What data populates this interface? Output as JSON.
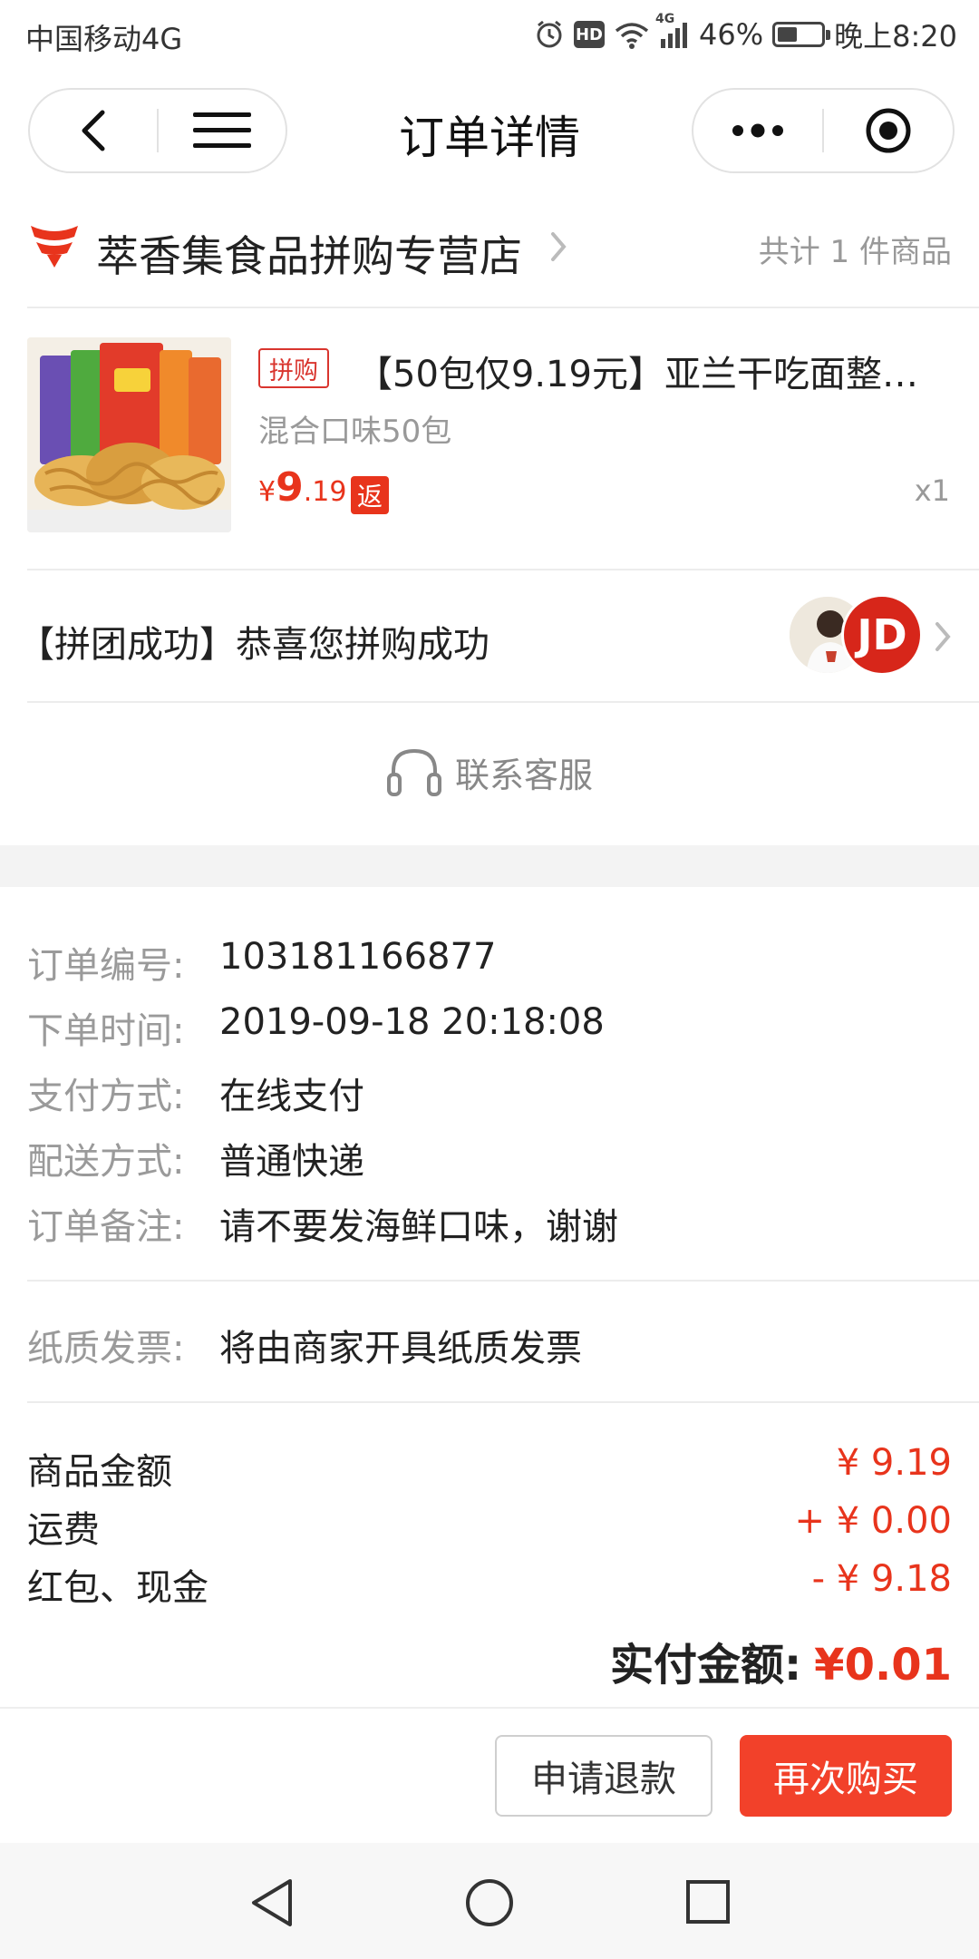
{
  "status_bar": {
    "carrier": "中国移动4G",
    "hd": "HD",
    "network": "4G",
    "battery": "46%",
    "battery_fraction": 0.46,
    "time": "晚上8:20"
  },
  "nav": {
    "title": "订单详情",
    "back_icon": "chevron-left-icon",
    "menu_icon": "hamburger-menu-icon",
    "more_icon": "more-dots-icon",
    "close_icon": "target-circle-icon"
  },
  "shop": {
    "name": "萃香集食品拼购专营店",
    "item_count": "共计 1 件商品",
    "logo_icon": "shop-logo-icon",
    "logo_color": "#e8341c"
  },
  "product": {
    "tag": "拼购",
    "title": "【50包仅9.19元】亚兰干吃面整…",
    "spec": "混合口味50包",
    "price_currency": "¥",
    "price_int": "9",
    "price_dec": ".19",
    "rebate_tag": "返",
    "quantity": "x1"
  },
  "group": {
    "text": "【拼团成功】恭喜您拼购成功",
    "avatar_text": "JD"
  },
  "customer_service": {
    "label": "联系客服",
    "icon": "headset-icon"
  },
  "order_info": [
    {
      "label": "订单编号:",
      "value": "103181166877"
    },
    {
      "label": "下单时间:",
      "value": "2019-09-18 20:18:08"
    },
    {
      "label": "支付方式:",
      "value": "在线支付"
    },
    {
      "label": "配送方式:",
      "value": "普通快递"
    },
    {
      "label": "订单备注:",
      "value": "请不要发海鲜口味，谢谢"
    }
  ],
  "invoice": {
    "label": "纸质发票:",
    "value": "将由商家开具纸质发票"
  },
  "totals": [
    {
      "label": "商品金额",
      "value": "¥ 9.19"
    },
    {
      "label": "运费",
      "value": "+ ¥ 0.00"
    },
    {
      "label": "红包、现金",
      "value": "- ¥ 9.18"
    }
  ],
  "paid": {
    "label": "实付金额:",
    "value": "¥0.01"
  },
  "actions": {
    "refund": "申请退款",
    "rebuy": "再次购买"
  },
  "colors": {
    "accent_red": "#e8341c",
    "button_red": "#f2412a",
    "muted": "#999999"
  }
}
